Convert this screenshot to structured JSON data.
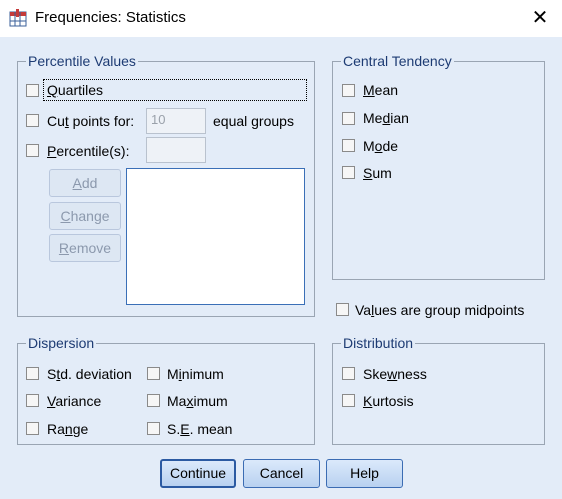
{
  "window": {
    "title": "Frequencies: Statistics",
    "close_glyph": "✕",
    "icon": "spss-table-icon"
  },
  "percentile_values": {
    "legend": "Percentile Values",
    "quartiles": {
      "pre": "",
      "u": "Q",
      "post": "uartiles",
      "checked": false
    },
    "cut_points": {
      "pre": "Cu",
      "u": "t",
      "post": " points for:",
      "checked": false,
      "value": "10",
      "suffix": "equal groups"
    },
    "percentiles": {
      "pre": "",
      "u": "P",
      "post": "ercentile(s):",
      "checked": false,
      "value": ""
    },
    "add": {
      "pre": "",
      "u": "A",
      "post": "dd"
    },
    "change": {
      "pre": "",
      "u": "C",
      "post": "hange"
    },
    "remove": {
      "pre": "",
      "u": "R",
      "post": "emove"
    }
  },
  "central_tendency": {
    "legend": "Central Tendency",
    "items": [
      {
        "pre": "",
        "u": "M",
        "post": "ean",
        "checked": false
      },
      {
        "pre": "Me",
        "u": "d",
        "post": "ian",
        "checked": false
      },
      {
        "pre": "M",
        "u": "o",
        "post": "de",
        "checked": false
      },
      {
        "pre": "",
        "u": "S",
        "post": "um",
        "checked": false
      }
    ]
  },
  "group_midpoints": {
    "pre": "Va",
    "u": "l",
    "post": "ues are group midpoints",
    "checked": false
  },
  "dispersion": {
    "legend": "Dispersion",
    "items": [
      {
        "pre": "S",
        "u": "t",
        "post": "d. deviation",
        "checked": false
      },
      {
        "pre": "M",
        "u": "i",
        "post": "nimum",
        "checked": false
      },
      {
        "pre": "",
        "u": "V",
        "post": "ariance",
        "checked": false
      },
      {
        "pre": "Ma",
        "u": "x",
        "post": "imum",
        "checked": false
      },
      {
        "pre": "Ra",
        "u": "n",
        "post": "ge",
        "checked": false
      },
      {
        "pre": "S.",
        "u": "E",
        "post": ". mean",
        "checked": false
      }
    ]
  },
  "distribution": {
    "legend": "Distribution",
    "items": [
      {
        "pre": "Ske",
        "u": "w",
        "post": "ness",
        "checked": false
      },
      {
        "pre": "",
        "u": "K",
        "post": "urtosis",
        "checked": false
      }
    ]
  },
  "buttons": {
    "continue": "Continue",
    "cancel": "Cancel",
    "help": "Help"
  }
}
